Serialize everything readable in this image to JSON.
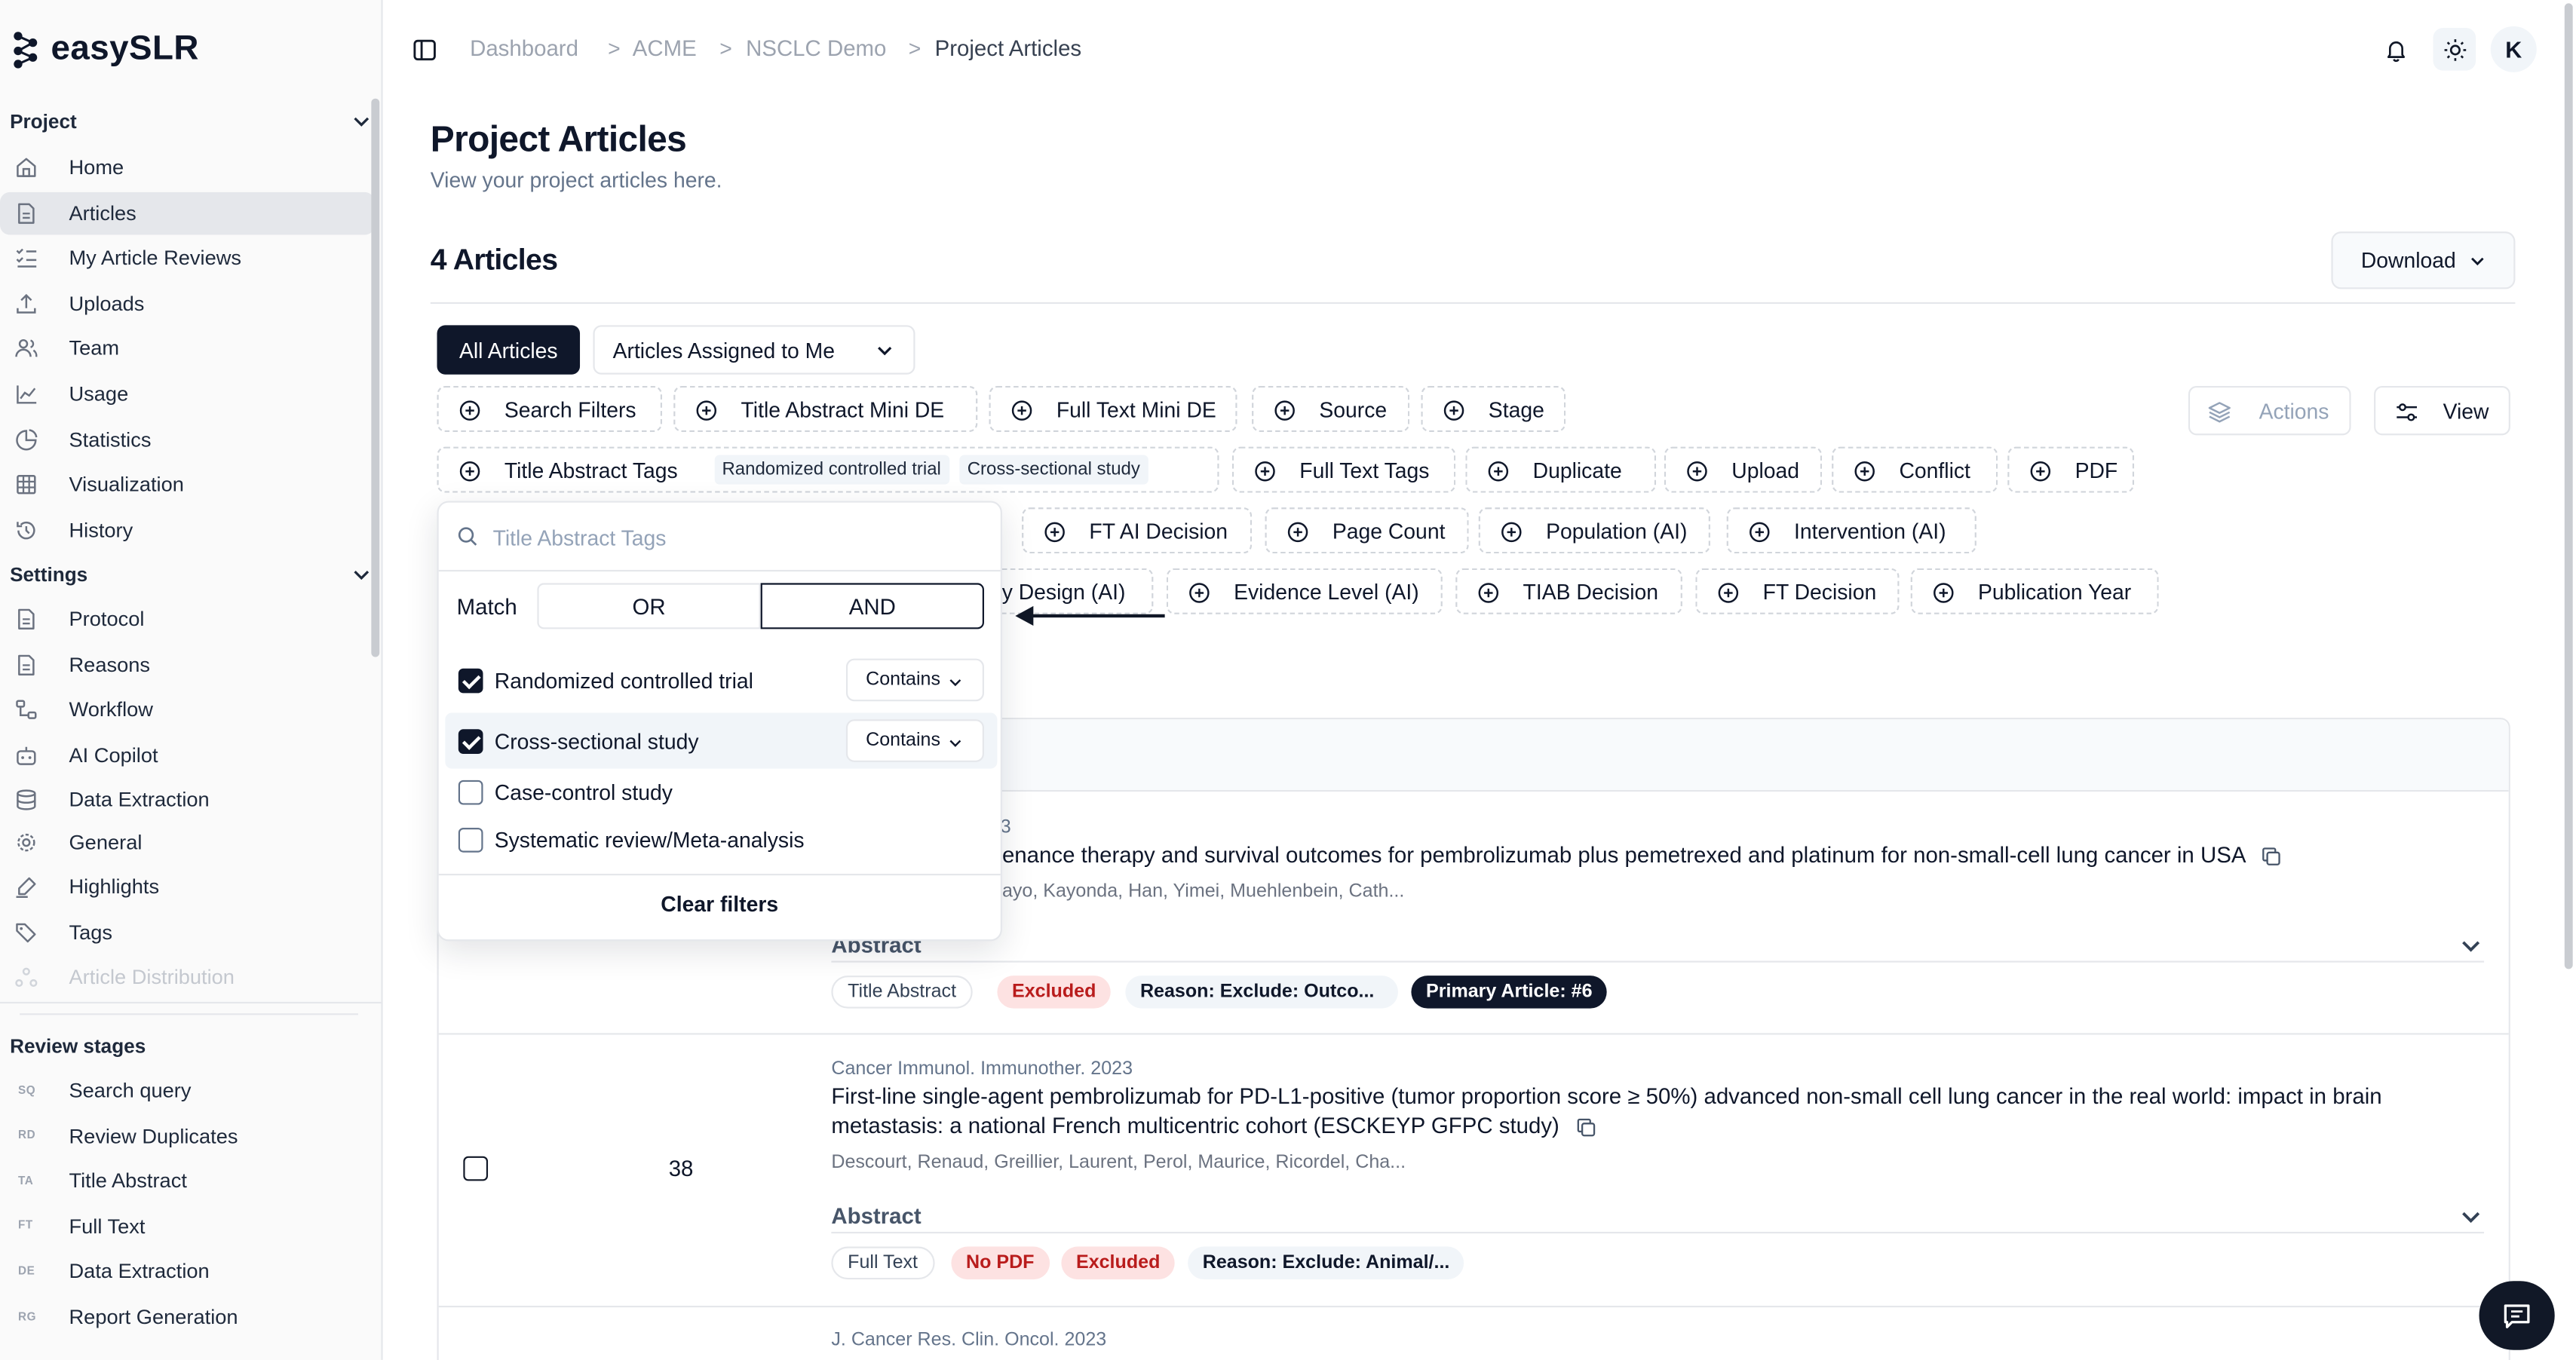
{
  "app": {
    "logo_text": "easySLR"
  },
  "sidebar": {
    "project_header": "Project",
    "project_items": [
      {
        "label": "Home",
        "icon": "home-icon"
      },
      {
        "label": "Articles",
        "icon": "file-icon"
      },
      {
        "label": "My Article Reviews",
        "icon": "list-check-icon"
      },
      {
        "label": "Uploads",
        "icon": "upload-icon"
      },
      {
        "label": "Team",
        "icon": "users-icon"
      },
      {
        "label": "Usage",
        "icon": "line-chart-icon"
      },
      {
        "label": "Statistics",
        "icon": "pie-chart-icon"
      },
      {
        "label": "Visualization",
        "icon": "grid-icon"
      },
      {
        "label": "History",
        "icon": "history-icon"
      }
    ],
    "settings_header": "Settings",
    "settings_items": [
      {
        "label": "Protocol",
        "icon": "file-icon"
      },
      {
        "label": "Reasons",
        "icon": "file-icon"
      },
      {
        "label": "Workflow",
        "icon": "workflow-icon"
      },
      {
        "label": "AI Copilot",
        "icon": "bot-icon"
      },
      {
        "label": "Data Extraction",
        "icon": "database-icon"
      },
      {
        "label": "General",
        "icon": "gear-icon"
      },
      {
        "label": "Highlights",
        "icon": "highlighter-icon"
      },
      {
        "label": "Tags",
        "icon": "tags-icon"
      },
      {
        "label": "Article Distribution",
        "icon": "distribution-icon"
      }
    ],
    "review_header": "Review stages",
    "review_items": [
      {
        "abbr": "SQ",
        "label": "Search query"
      },
      {
        "abbr": "RD",
        "label": "Review Duplicates"
      },
      {
        "abbr": "TA",
        "label": "Title Abstract"
      },
      {
        "abbr": "FT",
        "label": "Full Text"
      },
      {
        "abbr": "DE",
        "label": "Data Extraction"
      },
      {
        "abbr": "RG",
        "label": "Report Generation"
      }
    ]
  },
  "breadcrumb": [
    "Dashboard",
    "ACME",
    "NSCLC Demo",
    "Project Articles"
  ],
  "user": {
    "initial": "K"
  },
  "page": {
    "title": "Project Articles",
    "subtitle": "View your project articles here.",
    "count_label": "4 Articles",
    "download_label": "Download"
  },
  "tabs": {
    "all": "All Articles",
    "assigned": "Articles Assigned to Me"
  },
  "filters": {
    "row1": [
      "Search Filters",
      "Title Abstract Mini DE",
      "Full Text Mini DE",
      "Source",
      "Stage"
    ],
    "title_abstract_tags": "Title Abstract Tags",
    "selected_tags": [
      "Randomized controlled trial",
      "Cross-sectional study"
    ],
    "row2": [
      "Full Text Tags",
      "Duplicate",
      "Upload",
      "Conflict",
      "PDF"
    ],
    "row3": [
      "FT AI Decision",
      "Page Count",
      "Population (AI)",
      "Intervention (AI)"
    ],
    "row4_partial": "ly Design (AI)",
    "row4": [
      "Evidence Level (AI)",
      "TIAB Decision",
      "FT Decision",
      "Publication Year"
    ],
    "actions_label": "Actions",
    "view_label": "View"
  },
  "popover": {
    "search_placeholder": "Title Abstract Tags",
    "match_label": "Match",
    "or_label": "OR",
    "and_label": "AND",
    "options": [
      {
        "label": "Randomized controlled trial",
        "checked": true,
        "op": "Contains"
      },
      {
        "label": "Cross-sectional study",
        "checked": true,
        "op": "Contains"
      },
      {
        "label": "Case-control study",
        "checked": false
      },
      {
        "label": "Systematic review/Meta-analysis",
        "checked": false
      }
    ],
    "clear_label": "Clear filters"
  },
  "articles": [
    {
      "journal_partial": "3",
      "title_partial": "enance therapy and survival outcomes for pembrolizumab plus pemetrexed and platinum for non-small-cell lung cancer in USA",
      "authors_partial": "ayo, Kayonda, Han, Yimei, Muehlenbein, Cath...",
      "abstract_label": "Abstract",
      "badges": [
        "Title Abstract",
        "Excluded",
        "Reason: Exclude: Outco...",
        "Primary Article: #6"
      ]
    },
    {
      "number": "38",
      "journal": "Cancer Immunol. Immunother. 2023",
      "title_line1": "First-line single-agent pembrolizumab for PD-L1-positive (tumor proportion score ≥ 50%) advanced non-small cell lung cancer in the real world: impact in brain",
      "title_line2": "metastasis: a national French multicentric cohort (ESCKEYP GFPC study)",
      "authors": "Descourt, Renaud, Greillier, Laurent, Perol, Maurice, Ricordel, Cha...",
      "abstract_label": "Abstract",
      "badges": [
        "Full Text",
        "No PDF",
        "Excluded",
        "Reason: Exclude: Animal/..."
      ]
    },
    {
      "journal": "J. Cancer Res. Clin. Oncol. 2023"
    }
  ]
}
